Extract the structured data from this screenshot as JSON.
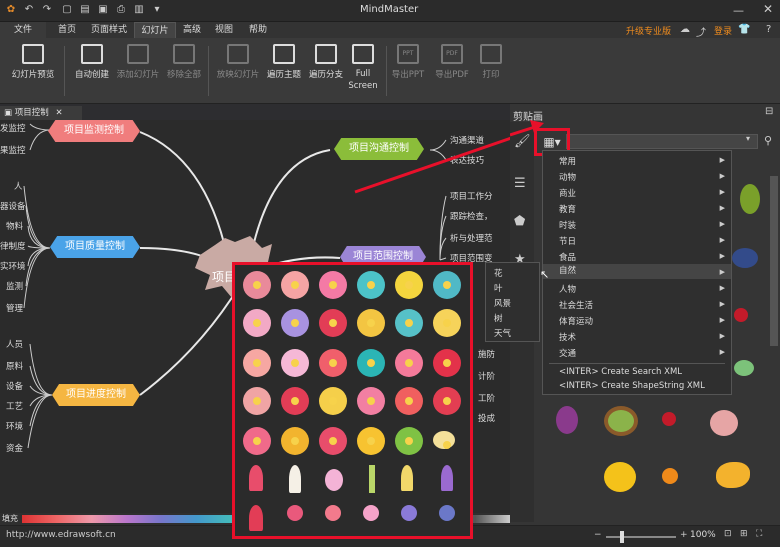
{
  "app": {
    "title": "MindMaster",
    "upgrade": "升级专业版",
    "login": "登录"
  },
  "menu": {
    "file": "文件",
    "tabs": [
      "首页",
      "页面样式",
      "幻灯片",
      "高级",
      "视图",
      "帮助"
    ]
  },
  "ribbon": {
    "buttons": [
      {
        "label": "幻灯片预览"
      },
      {
        "label": "自动创建"
      },
      {
        "label": "添加幻灯片"
      },
      {
        "label": "移除全部"
      },
      {
        "label": "放映幻灯片"
      },
      {
        "label": "遍历主题"
      },
      {
        "label": "遍历分支"
      },
      {
        "label": "Full Screen"
      },
      {
        "label": "导出PPT",
        "badge": "PPT"
      },
      {
        "label": "导出PDF",
        "badge": "PDF"
      },
      {
        "label": "打印"
      }
    ]
  },
  "doc_tab": {
    "label": "项目控制"
  },
  "mindmap": {
    "center": "项目",
    "nodes": {
      "monitor": "项目监测控制",
      "quality": "项目质量控制",
      "progress": "项目进度控制",
      "comm": "项目沟通控制",
      "scope": "项目范围控制"
    },
    "monitor_items": [
      "发监控",
      "果监控"
    ],
    "quality_items": [
      "人",
      "器设备",
      "物料",
      "律制度",
      "实环境",
      "监测",
      "管理"
    ],
    "progress_items": [
      "人员",
      "原料",
      "设备",
      "工艺",
      "环境",
      "资金"
    ],
    "comm_items": [
      "沟通渠道",
      "表达技巧"
    ],
    "scope_items": [
      "项目工作分",
      "跟踪检查，",
      "析与处理范",
      "项目范围变"
    ],
    "partial_right": [
      "施防",
      "计阶",
      "工阶",
      "投成"
    ]
  },
  "fill_label": "填充",
  "status": {
    "url": "http://www.edrawsoft.cn",
    "zoom": "100%"
  },
  "panel": {
    "title": "剪贴画"
  },
  "category_menu": {
    "items": [
      "常用",
      "动物",
      "商业",
      "教育",
      "时装",
      "节日",
      "食品",
      "自然",
      "人物",
      "社会生活",
      "体育运动",
      "技术",
      "交通",
      "<INTER> Create Search XML",
      "<INTER> Create ShapeString XML"
    ],
    "highlighted": "自然"
  },
  "submenu": {
    "items": [
      "花",
      "叶",
      "风景",
      "树",
      "天气"
    ]
  },
  "colors": {
    "accent": "#e8102a",
    "monitor": "#f07d7d",
    "quality": "#4aa3e8",
    "progress": "#f5b642",
    "comm": "#8bbd3a",
    "scope": "#9b85d6"
  }
}
